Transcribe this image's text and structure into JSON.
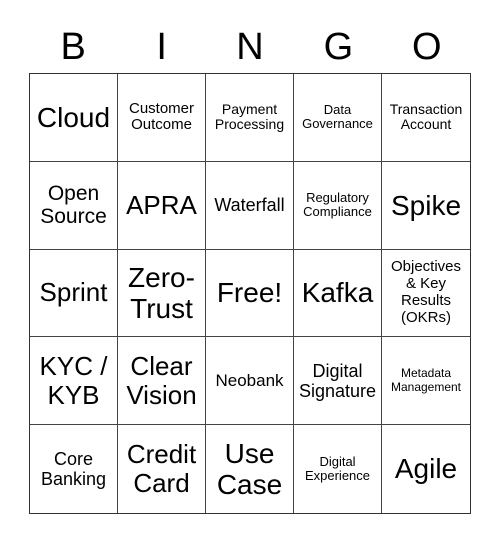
{
  "header": [
    "B",
    "I",
    "N",
    "G",
    "O"
  ],
  "cells": [
    "Cloud",
    "Customer Outcome",
    "Payment Processing",
    "Data Governance",
    "Transaction Account",
    "Open Source",
    "APRA",
    "Waterfall",
    "Regulatory Compliance",
    "Spike",
    "Sprint",
    "Zero-Trust",
    "Free!",
    "Kafka",
    "Objectives & Key Results (OKRs)",
    "KYC / KYB",
    "Clear Vision",
    "Neobank",
    "Digital Signature",
    "Metadata Management",
    "Core Banking",
    "Credit Card",
    "Use Case",
    "Digital Experience",
    "Agile"
  ]
}
